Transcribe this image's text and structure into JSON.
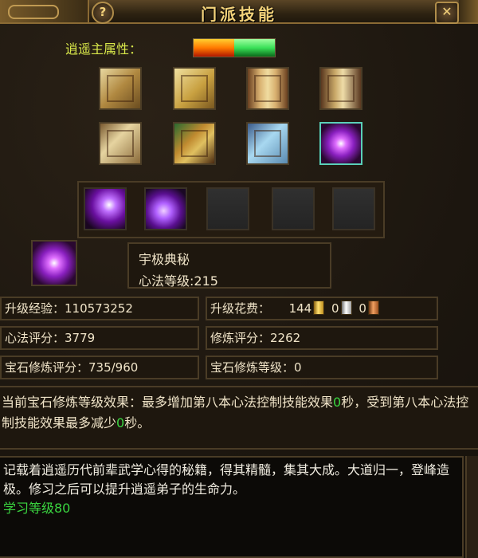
{
  "window": {
    "title": "门派技能",
    "help_label": "?",
    "close_label": "✕"
  },
  "attribute": {
    "label": "逍遥主属性：",
    "colors": [
      "#ff6a00",
      "#2ee04a"
    ]
  },
  "books": [
    {
      "icon": "bundled-books-icon"
    },
    {
      "icon": "golden-book-icon"
    },
    {
      "icon": "bamboo-scroll-icon"
    },
    {
      "icon": "open-scroll-icon"
    },
    {
      "icon": "painting-scroll-icon"
    },
    {
      "icon": "treasure-box-icon"
    },
    {
      "icon": "blue-scroll-icon"
    },
    {
      "icon": "purple-vortex-icon",
      "selected": true
    }
  ],
  "skill_slots": [
    {
      "icon": "purple-figure-skill-icon"
    },
    {
      "icon": "purple-spiral-skill-icon"
    },
    {
      "icon": "empty-slot"
    },
    {
      "icon": "empty-slot"
    },
    {
      "icon": "empty-slot"
    }
  ],
  "skill": {
    "icon": "purple-vortex-icon",
    "name": "宇极典秘",
    "level_text": "心法等级:215"
  },
  "stats": {
    "upgrade_exp": "升级经验：110573252",
    "upgrade_cost_label": "升级花费：",
    "cost_gold": "144",
    "cost_silver": "0",
    "cost_copper": "0",
    "xinfa_score": "心法评分：3779",
    "training_score": "修炼评分：2262",
    "gem_training_score": "宝石修炼评分：735/960",
    "gem_training_level": "宝石修炼等级：0"
  },
  "effect": {
    "part1": "当前宝石修炼等级效果：最多增加第八本心法控制技能效果",
    "value1": "0",
    "part2": "秒，受到第八本心法控制技能效果最多减少",
    "value2": "0",
    "part3": "秒。"
  },
  "description": {
    "text": "记载着逍遥历代前辈武学心得的秘籍，得其精髓，集其大成。大道归一，登峰造极。修习之后可以提升逍遥弟子的生命力。",
    "requirement": "学习等级80"
  }
}
